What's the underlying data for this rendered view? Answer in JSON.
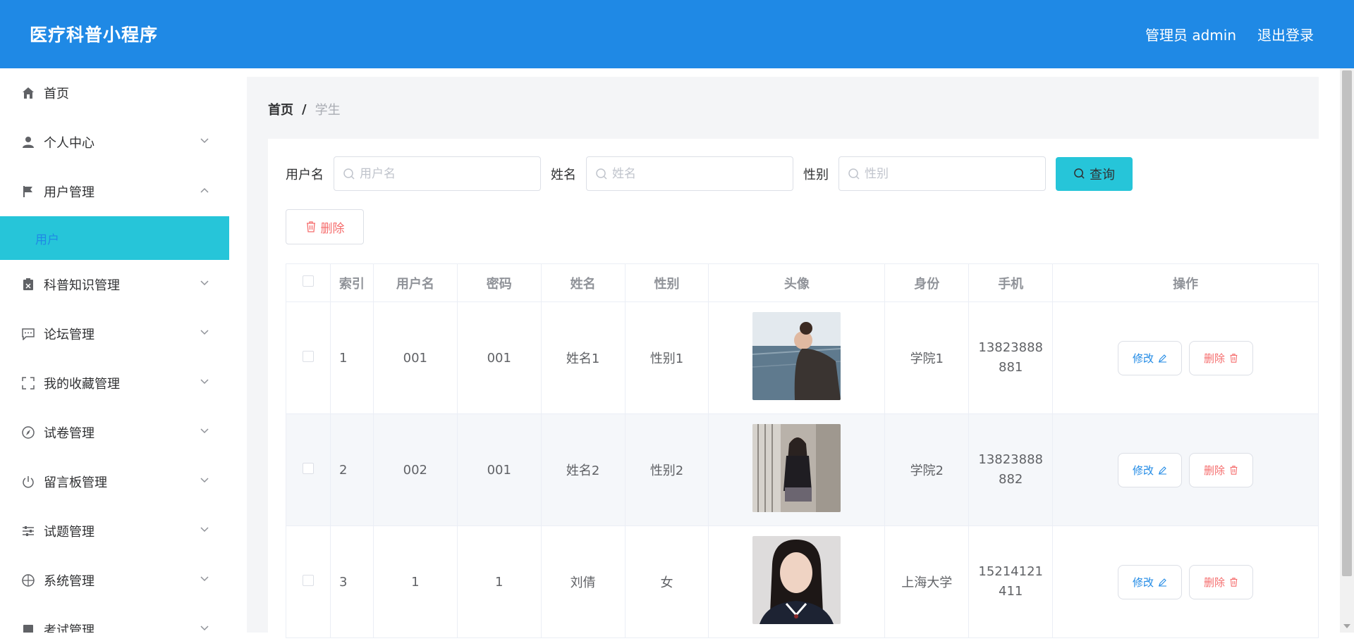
{
  "app": {
    "title": "医疗科普小程序"
  },
  "header": {
    "user_label": "管理员 admin",
    "logout_label": "退出登录"
  },
  "sidebar": {
    "items": [
      {
        "label": "首页",
        "icon": "home-icon",
        "has_chevron": false
      },
      {
        "label": "个人中心",
        "icon": "person-icon",
        "has_chevron": true,
        "expanded": false
      },
      {
        "label": "用户管理",
        "icon": "flag-icon",
        "has_chevron": true,
        "expanded": true
      },
      {
        "label": "科普知识管理",
        "icon": "clipboard-icon",
        "has_chevron": true,
        "expanded": false
      },
      {
        "label": "论坛管理",
        "icon": "chat-icon",
        "has_chevron": true,
        "expanded": false
      },
      {
        "label": "我的收藏管理",
        "icon": "fullscreen-icon",
        "has_chevron": true,
        "expanded": false
      },
      {
        "label": "试卷管理",
        "icon": "compass-icon",
        "has_chevron": true,
        "expanded": false
      },
      {
        "label": "留言板管理",
        "icon": "power-icon",
        "has_chevron": true,
        "expanded": false
      },
      {
        "label": "试题管理",
        "icon": "sliders-icon",
        "has_chevron": true,
        "expanded": false
      },
      {
        "label": "系统管理",
        "icon": "globe-icon",
        "has_chevron": true,
        "expanded": false
      },
      {
        "label": "考试管理",
        "icon": "book-icon",
        "has_chevron": true,
        "expanded": false
      }
    ],
    "active_subitem": "用户"
  },
  "breadcrumb": {
    "home": "首页",
    "separator": "/",
    "current": "学生"
  },
  "search": {
    "username_label": "用户名",
    "username_placeholder": "用户名",
    "name_label": "姓名",
    "name_placeholder": "姓名",
    "gender_label": "性别",
    "gender_placeholder": "性别",
    "query_label": "查询"
  },
  "toolbar": {
    "delete_label": "删除"
  },
  "table": {
    "headers": [
      "索引",
      "用户名",
      "密码",
      "姓名",
      "性别",
      "头像",
      "身份",
      "手机",
      "操作"
    ],
    "rows": [
      {
        "index": "1",
        "username": "001",
        "password": "001",
        "name": "姓名1",
        "gender": "性别1",
        "identity": "学院1",
        "phone": "13823888881"
      },
      {
        "index": "2",
        "username": "002",
        "password": "001",
        "name": "姓名2",
        "gender": "性别2",
        "identity": "学院2",
        "phone": "13823888882"
      },
      {
        "index": "3",
        "username": "1",
        "password": "1",
        "name": "刘倩",
        "gender": "女",
        "identity": "上海大学",
        "phone": "15214121411"
      }
    ],
    "edit_label": "修改",
    "delete_label": "删除"
  },
  "colors": {
    "header_bg": "#1f89e5",
    "accent_cyan": "#26c5d9",
    "danger": "#f56c6c"
  }
}
